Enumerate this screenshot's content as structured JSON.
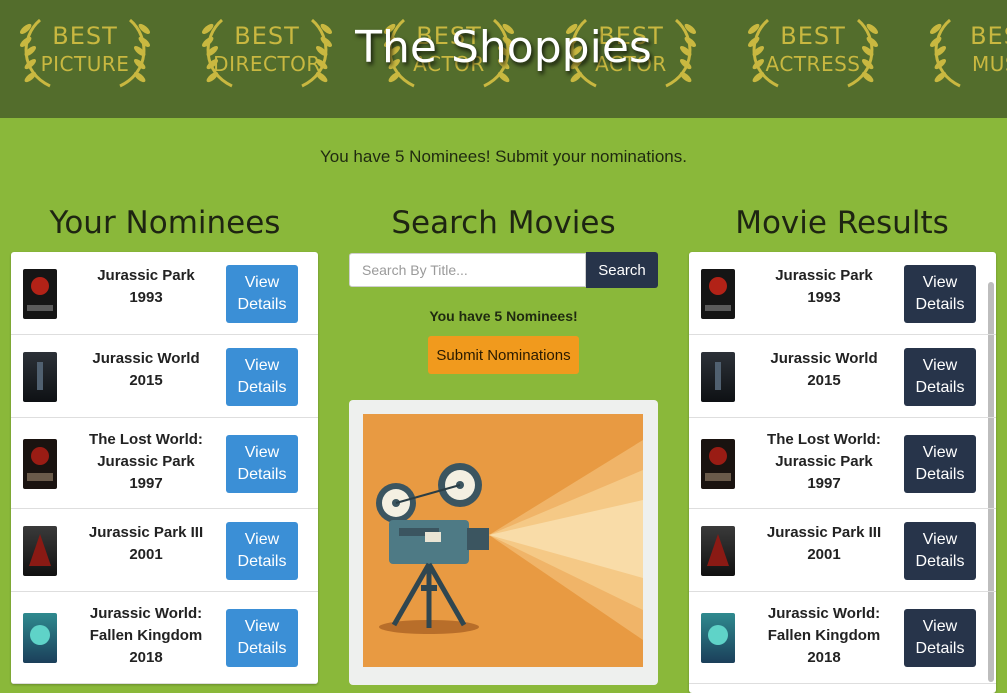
{
  "header": {
    "title": "The Shoppies",
    "awards": [
      {
        "line1": "BEST",
        "line2": "PICTURE"
      },
      {
        "line1": "BEST",
        "line2": "DIRECTOR"
      },
      {
        "line1": "BEST",
        "line2": "ACTOR"
      },
      {
        "line1": "BEST",
        "line2": "ACTOR"
      },
      {
        "line1": "BEST",
        "line2": "ACTRESS"
      },
      {
        "line1": "BES",
        "line2": "MUS"
      }
    ],
    "colors": {
      "bar": "#536d2c",
      "laurel": "#c9b840"
    }
  },
  "status_message": "You have 5 Nominees! Submit your nominations.",
  "nominees": {
    "heading": "Your Nominees",
    "items": [
      {
        "title": "Jurassic Park",
        "year": "1993",
        "button": "View Details"
      },
      {
        "title": "Jurassic World",
        "year": "2015",
        "button": "View Details"
      },
      {
        "title": "The Lost World: Jurassic Park",
        "year": "1997",
        "button": "View Details"
      },
      {
        "title": "Jurassic Park III",
        "year": "2001",
        "button": "View Details"
      },
      {
        "title": "Jurassic World: Fallen Kingdom",
        "year": "2018",
        "button": "View Details"
      }
    ]
  },
  "search": {
    "heading": "Search Movies",
    "placeholder": "Search By Title...",
    "button": "Search",
    "nominee_count": "You have 5 Nominees!",
    "submit_button": "Submit Nominations"
  },
  "results": {
    "heading": "Movie Results",
    "items": [
      {
        "title": "Jurassic Park",
        "year": "1993",
        "button": "View Details"
      },
      {
        "title": "Jurassic World",
        "year": "2015",
        "button": "View Details"
      },
      {
        "title": "The Lost World: Jurassic Park",
        "year": "1997",
        "button": "View Details"
      },
      {
        "title": "Jurassic Park III",
        "year": "2001",
        "button": "View Details"
      },
      {
        "title": "Jurassic World: Fallen Kingdom",
        "year": "2018",
        "button": "View Details"
      }
    ]
  },
  "colors": {
    "background": "#8ab83a",
    "view_button_nominee": "#3b8fd6",
    "view_button_result": "#27344a",
    "submit": "#f19a1d",
    "illustration_bg": "#e89a42"
  }
}
